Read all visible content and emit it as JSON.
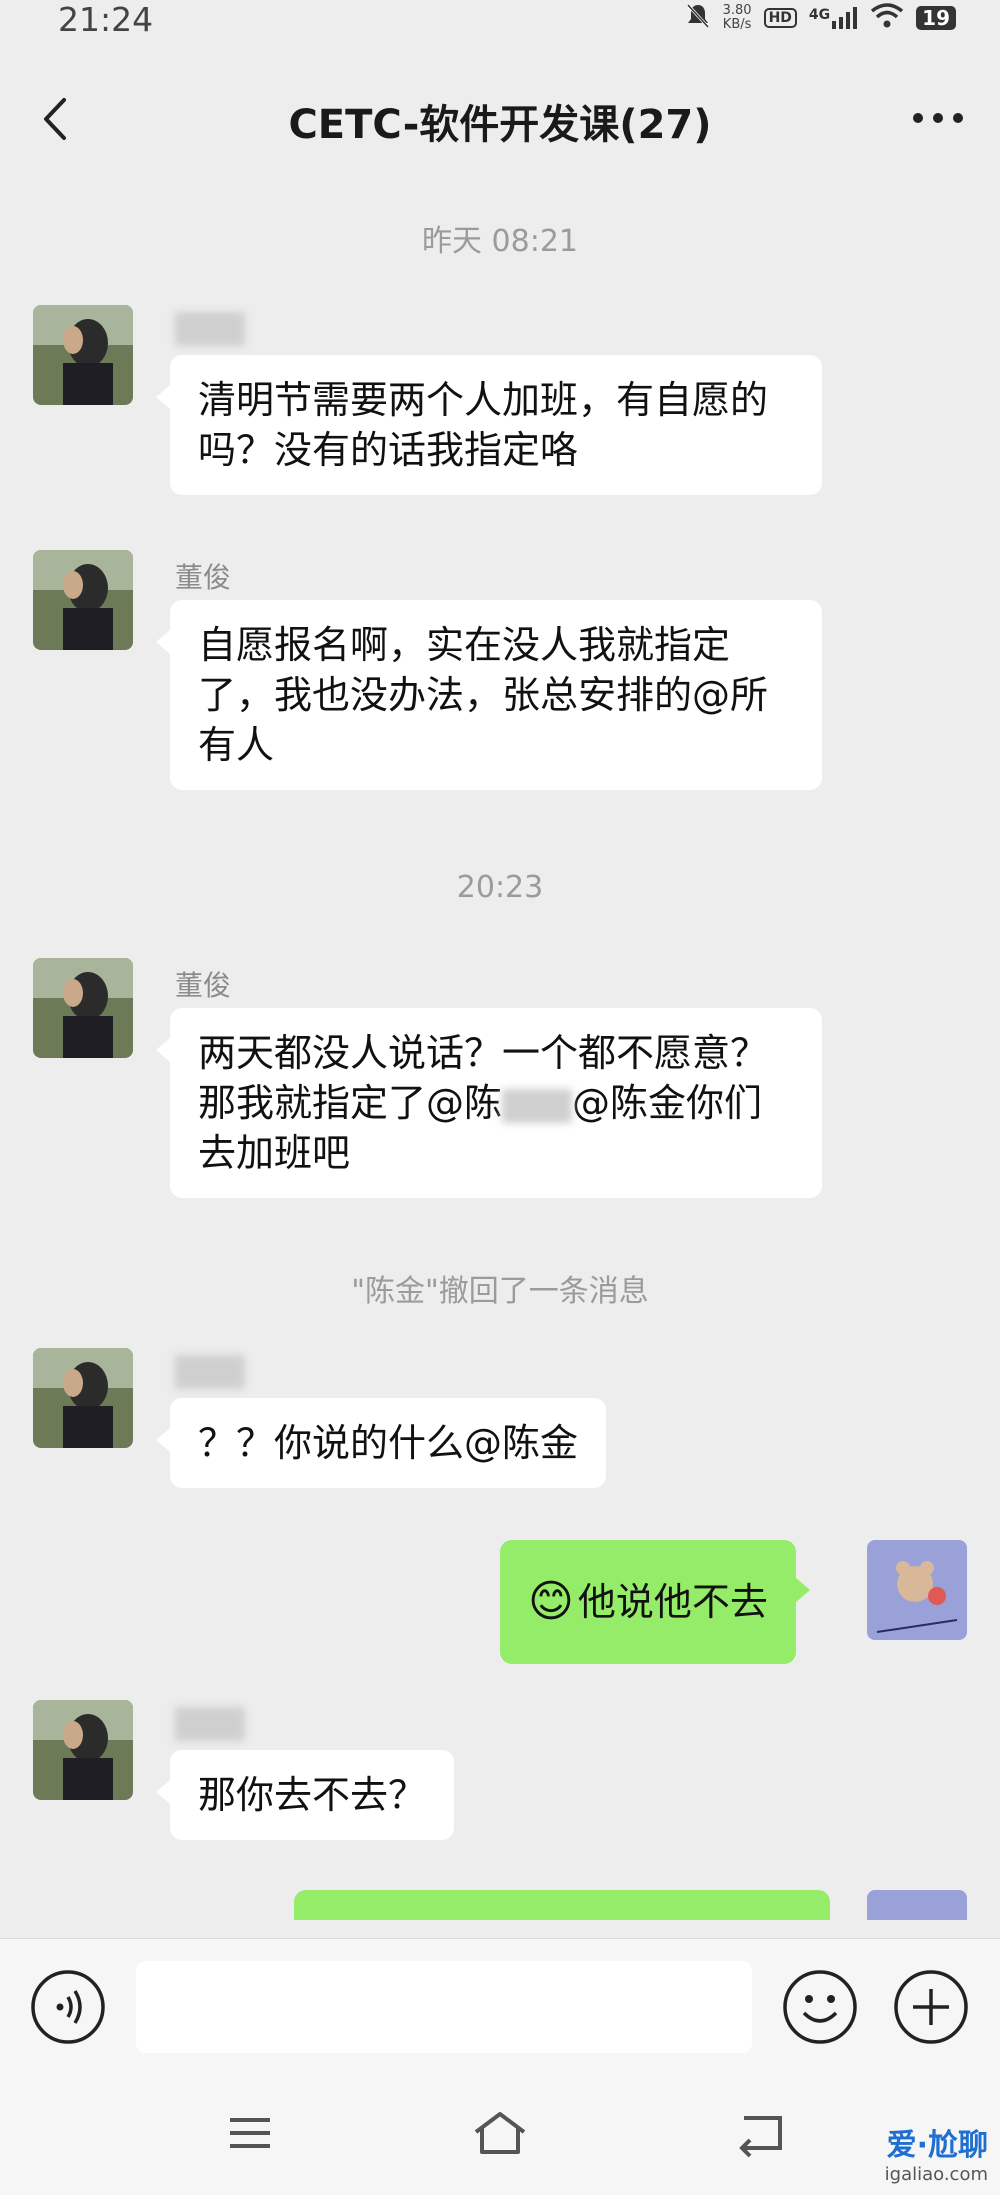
{
  "status_bar": {
    "time": "21:24",
    "speed_value": "3.80",
    "speed_unit": "KB/s",
    "hd": "HD",
    "network": "4G",
    "battery": "19"
  },
  "header": {
    "title": "CETC-软件开发课(27)"
  },
  "messages": {
    "ts1": "昨天 08:21",
    "m1": {
      "sender": "董俊",
      "text": "清明节需要两个人加班，有自愿的吗？没有的话我指定咯"
    },
    "m2": {
      "sender": "董俊",
      "text": "自愿报名啊，实在没人我就指定了，我也没办法，张总安排的@所有人"
    },
    "ts2": "20:23",
    "m3": {
      "sender": "董俊",
      "text": "两天都没人说话？一个都不愿意？那我就指定了@陈",
      "text_tail": "@陈金你们去加班吧"
    },
    "recall": "\"陈金\"撤回了一条消息",
    "m4": {
      "sender": "董俊",
      "text": "？？你说的什么@陈金"
    },
    "m5": {
      "emoji": "😊",
      "text": "他说他不去"
    },
    "m6": {
      "text": "那你去不去？"
    }
  },
  "colors": {
    "background": "#ededed",
    "bubble_in": "#ffffff",
    "bubble_out": "#95ec69"
  },
  "watermark": {
    "main": "爱·尬聊",
    "sub": "igaliao.com"
  }
}
